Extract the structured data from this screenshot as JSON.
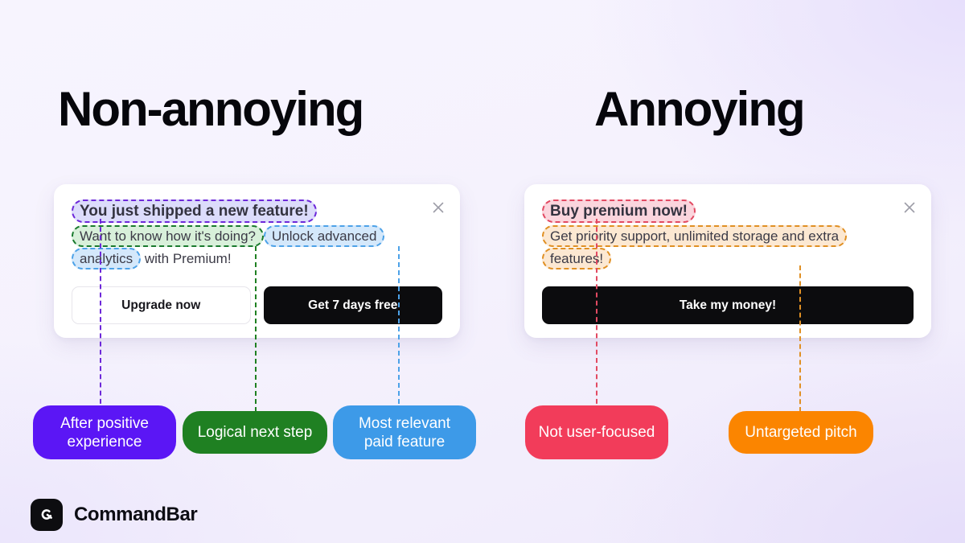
{
  "background": {
    "base_color": "#f5f2fd",
    "accent_color": "#e9e2fb"
  },
  "columns": {
    "left": {
      "heading": "Non-annoying"
    },
    "right": {
      "heading": "Annoying"
    }
  },
  "cards": {
    "left": {
      "close_icon": "close-icon",
      "title": "You just shipped a new feature!",
      "body_part_1": "Want to know how it's doing?",
      "body_part_2": "Unlock advanced analytics",
      "body_part_3": "with Premium!",
      "buttons": [
        {
          "label": "Upgrade now",
          "style": "outline"
        },
        {
          "label": "Get 7 days free",
          "style": "dark"
        }
      ]
    },
    "right": {
      "close_icon": "close-icon",
      "title": "Buy premium now!",
      "body_part_1": "Get priority support, unlimited storage and extra features!",
      "buttons": [
        {
          "label": "Take my money!",
          "style": "dark"
        }
      ]
    }
  },
  "annotations": [
    {
      "id": "after-positive-experience",
      "label": "After positive experience",
      "color": "#5b16f5",
      "highlight_fill": "#dcdcfb",
      "highlight_border": "#6d28d9"
    },
    {
      "id": "logical-next-step",
      "label": "Logical next step",
      "color": "#1f8022",
      "highlight_fill": "#d8f0da",
      "highlight_border": "#1a7a2e"
    },
    {
      "id": "most-relevant-paid-feature",
      "label": "Most relevant paid feature",
      "color": "#3d9ae8",
      "highlight_fill": "#d4e8fb",
      "highlight_border": "#4da2e8"
    },
    {
      "id": "not-user-focused",
      "label": "Not user-focused",
      "color": "#f23c5a",
      "highlight_fill": "#fbd5dd",
      "highlight_border": "#e24a62"
    },
    {
      "id": "untargeted-pitch",
      "label": "Untargeted pitch",
      "color": "#fb8500",
      "highlight_fill": "#fce8d2",
      "highlight_border": "#e09024"
    }
  ],
  "footer": {
    "logo_icon": "commandbar-logo-icon",
    "brand_name": "CommandBar"
  }
}
